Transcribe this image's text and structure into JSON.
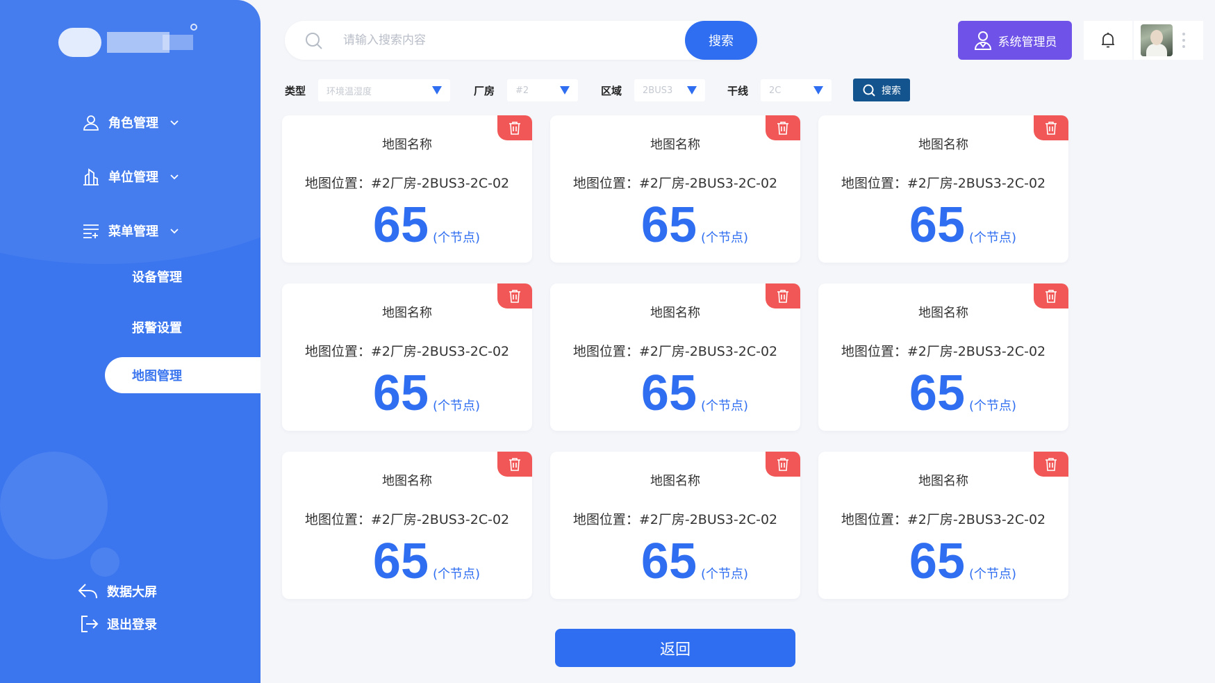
{
  "colors": {
    "sidebar": "#3b76ef",
    "primary": "#2f6ef0",
    "admin": "#6f52e8",
    "delete": "#f05756",
    "filter_search": "#13548f"
  },
  "sidebar": {
    "menu": [
      {
        "label": "角色管理",
        "icon": "user-icon"
      },
      {
        "label": "单位管理",
        "icon": "building-icon"
      },
      {
        "label": "菜单管理",
        "icon": "menu-list-icon"
      }
    ],
    "submenu": [
      {
        "label": "设备管理"
      },
      {
        "label": "报警设置"
      },
      {
        "label": "地图管理",
        "active": true
      }
    ],
    "footer": [
      {
        "label": "数据大屏",
        "icon": "back-arrow-icon"
      },
      {
        "label": "退出登录",
        "icon": "logout-icon"
      }
    ]
  },
  "header": {
    "search_placeholder": "请输入搜索内容",
    "search_button": "搜索",
    "admin_label": "系统管理员"
  },
  "filters": {
    "type": {
      "label": "类型",
      "value": "环境温湿度"
    },
    "factory": {
      "label": "厂房",
      "value": "#2"
    },
    "area": {
      "label": "区域",
      "value": "2BUS3"
    },
    "trunk": {
      "label": "干线",
      "value": "2C"
    },
    "search_button": "搜索"
  },
  "cards": [
    {
      "name": "地图名称",
      "location": "地图位置：#2厂房-2BUS3-2C-02",
      "count": "65",
      "unit": "(个节点)"
    },
    {
      "name": "地图名称",
      "location": "地图位置：#2厂房-2BUS3-2C-02",
      "count": "65",
      "unit": "(个节点)"
    },
    {
      "name": "地图名称",
      "location": "地图位置：#2厂房-2BUS3-2C-02",
      "count": "65",
      "unit": "(个节点)"
    },
    {
      "name": "地图名称",
      "location": "地图位置：#2厂房-2BUS3-2C-02",
      "count": "65",
      "unit": "(个节点)"
    },
    {
      "name": "地图名称",
      "location": "地图位置：#2厂房-2BUS3-2C-02",
      "count": "65",
      "unit": "(个节点)"
    },
    {
      "name": "地图名称",
      "location": "地图位置：#2厂房-2BUS3-2C-02",
      "count": "65",
      "unit": "(个节点)"
    },
    {
      "name": "地图名称",
      "location": "地图位置：#2厂房-2BUS3-2C-02",
      "count": "65",
      "unit": "(个节点)"
    },
    {
      "name": "地图名称",
      "location": "地图位置：#2厂房-2BUS3-2C-02",
      "count": "65",
      "unit": "(个节点)"
    },
    {
      "name": "地图名称",
      "location": "地图位置：#2厂房-2BUS3-2C-02",
      "count": "65",
      "unit": "(个节点)"
    }
  ],
  "back_button": "返回"
}
